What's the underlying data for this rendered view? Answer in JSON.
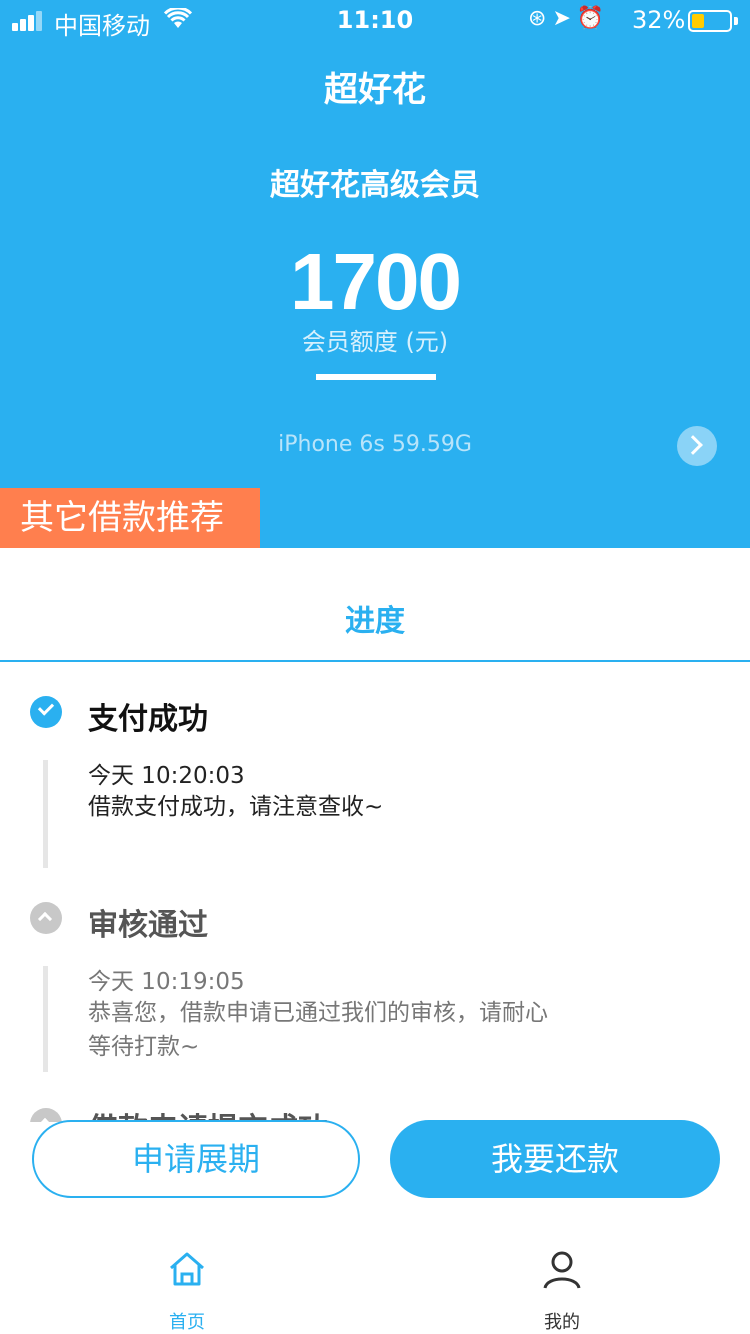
{
  "status_bar": {
    "carrier": "中国移动",
    "time": "11:10",
    "battery_percent": "32%",
    "battery_level": 0.32,
    "icons": [
      "signal-icon",
      "wifi-icon",
      "rotation-lock-icon",
      "location-icon",
      "alarm-icon",
      "battery-icon"
    ]
  },
  "header": {
    "title": "超好花"
  },
  "membership": {
    "title": "超好花高级会员",
    "amount": "1700",
    "amount_label": "会员额度 (元)",
    "device_info": "iPhone 6s  59.59G"
  },
  "promo": {
    "label": "其它借款推荐",
    "color": "#ff7f4e"
  },
  "tab": {
    "progress_label": "进度"
  },
  "timeline": [
    {
      "title": "支付成功",
      "time": "今天 10:20:03",
      "desc": "借款支付成功，请注意查收~",
      "status": "done"
    },
    {
      "title": "审核通过",
      "time": "今天 10:19:05",
      "desc": "恭喜您，借款申请已通过我们的审核，请耐心等待打款~",
      "status": "past"
    },
    {
      "title": "借款申请提交成功",
      "status": "past"
    }
  ],
  "actions": {
    "extend_label": "申请展期",
    "repay_label": "我要还款"
  },
  "tabbar": {
    "home_label": "首页",
    "mine_label": "我的"
  },
  "colors": {
    "accent": "#2ab0f0",
    "promo": "#ff7f4e",
    "battery": "#ffcc00"
  }
}
